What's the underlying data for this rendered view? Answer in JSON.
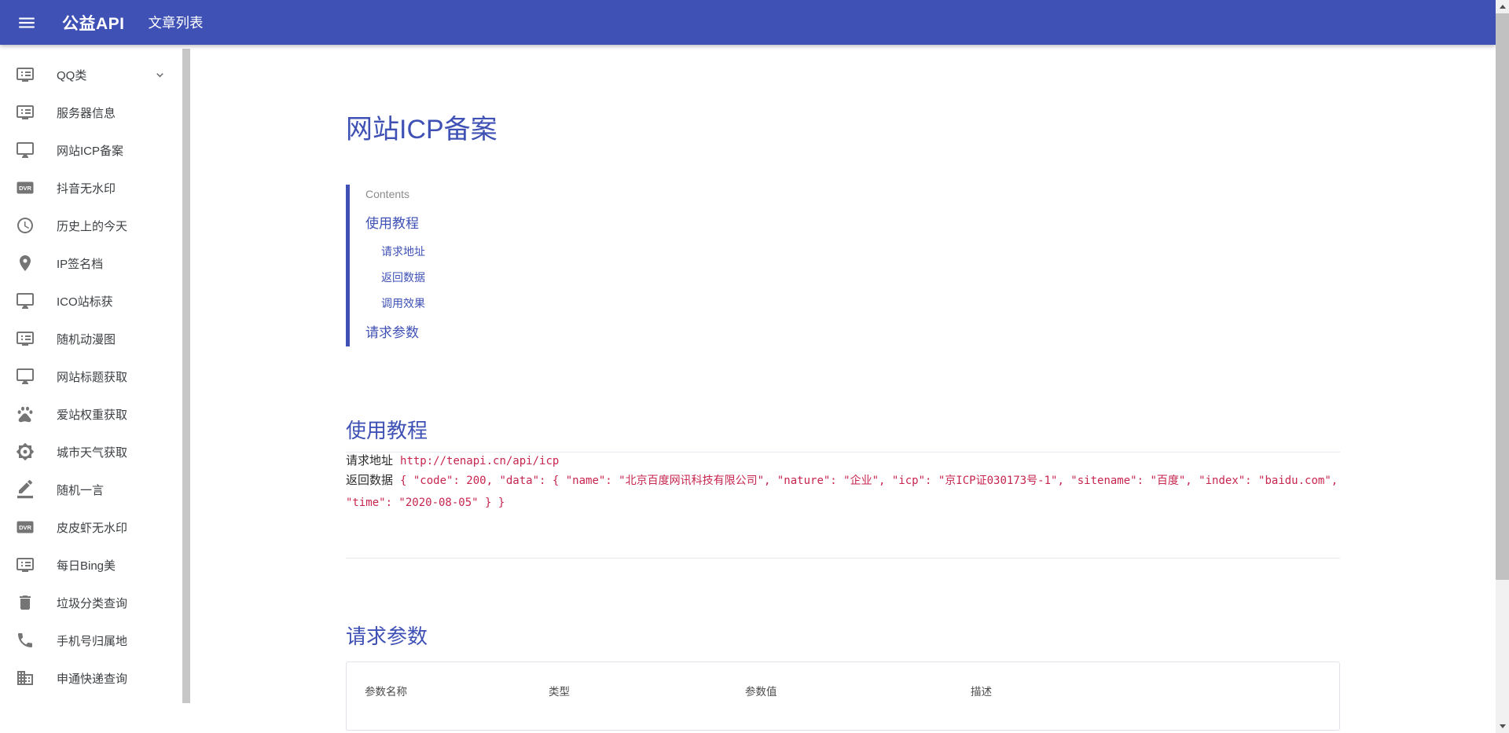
{
  "colors": {
    "accent": "#3f51b5",
    "code": "#c7254e",
    "icon_gray": "#757575"
  },
  "navbar": {
    "brand": "公益API",
    "links": [
      {
        "label": "文章列表"
      }
    ],
    "icons": [
      "menu-icon"
    ]
  },
  "sidebar": {
    "items": [
      {
        "label": "QQ类",
        "icon": "dvr-icon",
        "expandable": true
      },
      {
        "label": "服务器信息",
        "icon": "dvr-icon"
      },
      {
        "label": "网站ICP备案",
        "icon": "desktop-icon"
      },
      {
        "label": "抖音无水印",
        "icon": "fiber-dvr-icon"
      },
      {
        "label": "历史上的今天",
        "icon": "clock-icon"
      },
      {
        "label": "IP签名档",
        "icon": "location-pin-icon"
      },
      {
        "label": "ICO站标获",
        "icon": "desktop-icon"
      },
      {
        "label": "随机动漫图",
        "icon": "dvr-icon"
      },
      {
        "label": "网站标题获取",
        "icon": "desktop-icon"
      },
      {
        "label": "爱站权重获取",
        "icon": "paw-icon"
      },
      {
        "label": "城市天气获取",
        "icon": "brightness-icon"
      },
      {
        "label": "随机一言",
        "icon": "pencil-icon"
      },
      {
        "label": "皮皮虾无水印",
        "icon": "fiber-dvr-icon"
      },
      {
        "label": "每日Bing美",
        "icon": "dvr-icon"
      },
      {
        "label": "垃圾分类查询",
        "icon": "trash-icon"
      },
      {
        "label": "手机号归属地",
        "icon": "phone-icon"
      },
      {
        "label": "申通快递查询",
        "icon": "building-icon"
      }
    ]
  },
  "content": {
    "title": "网站ICP备案",
    "toc": {
      "label": "Contents",
      "items": [
        {
          "label": "使用教程",
          "level": 1
        },
        {
          "label": "请求地址",
          "level": 2
        },
        {
          "label": "返回数据",
          "level": 2
        },
        {
          "label": "调用效果",
          "level": 2
        },
        {
          "label": "请求参数",
          "level": 1
        }
      ]
    },
    "usage": {
      "heading": "使用教程",
      "request_label": "请求地址",
      "request_code": "http://tenapi.cn/api/icp",
      "return_label": "返回数据",
      "return_code": "{ \"code\": 200, \"data\": { \"name\": \"北京百度网讯科技有限公司\", \"nature\": \"企业\", \"icp\": \"京ICP证030173号-1\", \"sitename\": \"百度\", \"index\": \"baidu.com\", \"time\": \"2020-08-05\" } }"
    },
    "params": {
      "heading": "请求参数",
      "table_headers": [
        "参数名称",
        "类型",
        "参数值",
        "描述"
      ]
    }
  }
}
